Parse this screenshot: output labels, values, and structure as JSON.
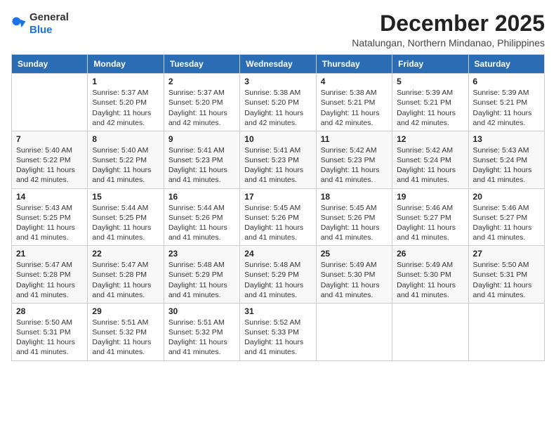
{
  "logo": {
    "general": "General",
    "blue": "Blue"
  },
  "header": {
    "month": "December 2025",
    "location": "Natalungan, Northern Mindanao, Philippines"
  },
  "weekdays": [
    "Sunday",
    "Monday",
    "Tuesday",
    "Wednesday",
    "Thursday",
    "Friday",
    "Saturday"
  ],
  "weeks": [
    [
      {
        "day": "",
        "info": ""
      },
      {
        "day": "1",
        "info": "Sunrise: 5:37 AM\nSunset: 5:20 PM\nDaylight: 11 hours\nand 42 minutes."
      },
      {
        "day": "2",
        "info": "Sunrise: 5:37 AM\nSunset: 5:20 PM\nDaylight: 11 hours\nand 42 minutes."
      },
      {
        "day": "3",
        "info": "Sunrise: 5:38 AM\nSunset: 5:20 PM\nDaylight: 11 hours\nand 42 minutes."
      },
      {
        "day": "4",
        "info": "Sunrise: 5:38 AM\nSunset: 5:21 PM\nDaylight: 11 hours\nand 42 minutes."
      },
      {
        "day": "5",
        "info": "Sunrise: 5:39 AM\nSunset: 5:21 PM\nDaylight: 11 hours\nand 42 minutes."
      },
      {
        "day": "6",
        "info": "Sunrise: 5:39 AM\nSunset: 5:21 PM\nDaylight: 11 hours\nand 42 minutes."
      }
    ],
    [
      {
        "day": "7",
        "info": "Sunrise: 5:40 AM\nSunset: 5:22 PM\nDaylight: 11 hours\nand 42 minutes."
      },
      {
        "day": "8",
        "info": "Sunrise: 5:40 AM\nSunset: 5:22 PM\nDaylight: 11 hours\nand 41 minutes."
      },
      {
        "day": "9",
        "info": "Sunrise: 5:41 AM\nSunset: 5:23 PM\nDaylight: 11 hours\nand 41 minutes."
      },
      {
        "day": "10",
        "info": "Sunrise: 5:41 AM\nSunset: 5:23 PM\nDaylight: 11 hours\nand 41 minutes."
      },
      {
        "day": "11",
        "info": "Sunrise: 5:42 AM\nSunset: 5:23 PM\nDaylight: 11 hours\nand 41 minutes."
      },
      {
        "day": "12",
        "info": "Sunrise: 5:42 AM\nSunset: 5:24 PM\nDaylight: 11 hours\nand 41 minutes."
      },
      {
        "day": "13",
        "info": "Sunrise: 5:43 AM\nSunset: 5:24 PM\nDaylight: 11 hours\nand 41 minutes."
      }
    ],
    [
      {
        "day": "14",
        "info": "Sunrise: 5:43 AM\nSunset: 5:25 PM\nDaylight: 11 hours\nand 41 minutes."
      },
      {
        "day": "15",
        "info": "Sunrise: 5:44 AM\nSunset: 5:25 PM\nDaylight: 11 hours\nand 41 minutes."
      },
      {
        "day": "16",
        "info": "Sunrise: 5:44 AM\nSunset: 5:26 PM\nDaylight: 11 hours\nand 41 minutes."
      },
      {
        "day": "17",
        "info": "Sunrise: 5:45 AM\nSunset: 5:26 PM\nDaylight: 11 hours\nand 41 minutes."
      },
      {
        "day": "18",
        "info": "Sunrise: 5:45 AM\nSunset: 5:26 PM\nDaylight: 11 hours\nand 41 minutes."
      },
      {
        "day": "19",
        "info": "Sunrise: 5:46 AM\nSunset: 5:27 PM\nDaylight: 11 hours\nand 41 minutes."
      },
      {
        "day": "20",
        "info": "Sunrise: 5:46 AM\nSunset: 5:27 PM\nDaylight: 11 hours\nand 41 minutes."
      }
    ],
    [
      {
        "day": "21",
        "info": "Sunrise: 5:47 AM\nSunset: 5:28 PM\nDaylight: 11 hours\nand 41 minutes."
      },
      {
        "day": "22",
        "info": "Sunrise: 5:47 AM\nSunset: 5:28 PM\nDaylight: 11 hours\nand 41 minutes."
      },
      {
        "day": "23",
        "info": "Sunrise: 5:48 AM\nSunset: 5:29 PM\nDaylight: 11 hours\nand 41 minutes."
      },
      {
        "day": "24",
        "info": "Sunrise: 5:48 AM\nSunset: 5:29 PM\nDaylight: 11 hours\nand 41 minutes."
      },
      {
        "day": "25",
        "info": "Sunrise: 5:49 AM\nSunset: 5:30 PM\nDaylight: 11 hours\nand 41 minutes."
      },
      {
        "day": "26",
        "info": "Sunrise: 5:49 AM\nSunset: 5:30 PM\nDaylight: 11 hours\nand 41 minutes."
      },
      {
        "day": "27",
        "info": "Sunrise: 5:50 AM\nSunset: 5:31 PM\nDaylight: 11 hours\nand 41 minutes."
      }
    ],
    [
      {
        "day": "28",
        "info": "Sunrise: 5:50 AM\nSunset: 5:31 PM\nDaylight: 11 hours\nand 41 minutes."
      },
      {
        "day": "29",
        "info": "Sunrise: 5:51 AM\nSunset: 5:32 PM\nDaylight: 11 hours\nand 41 minutes."
      },
      {
        "day": "30",
        "info": "Sunrise: 5:51 AM\nSunset: 5:32 PM\nDaylight: 11 hours\nand 41 minutes."
      },
      {
        "day": "31",
        "info": "Sunrise: 5:52 AM\nSunset: 5:33 PM\nDaylight: 11 hours\nand 41 minutes."
      },
      {
        "day": "",
        "info": ""
      },
      {
        "day": "",
        "info": ""
      },
      {
        "day": "",
        "info": ""
      }
    ]
  ]
}
